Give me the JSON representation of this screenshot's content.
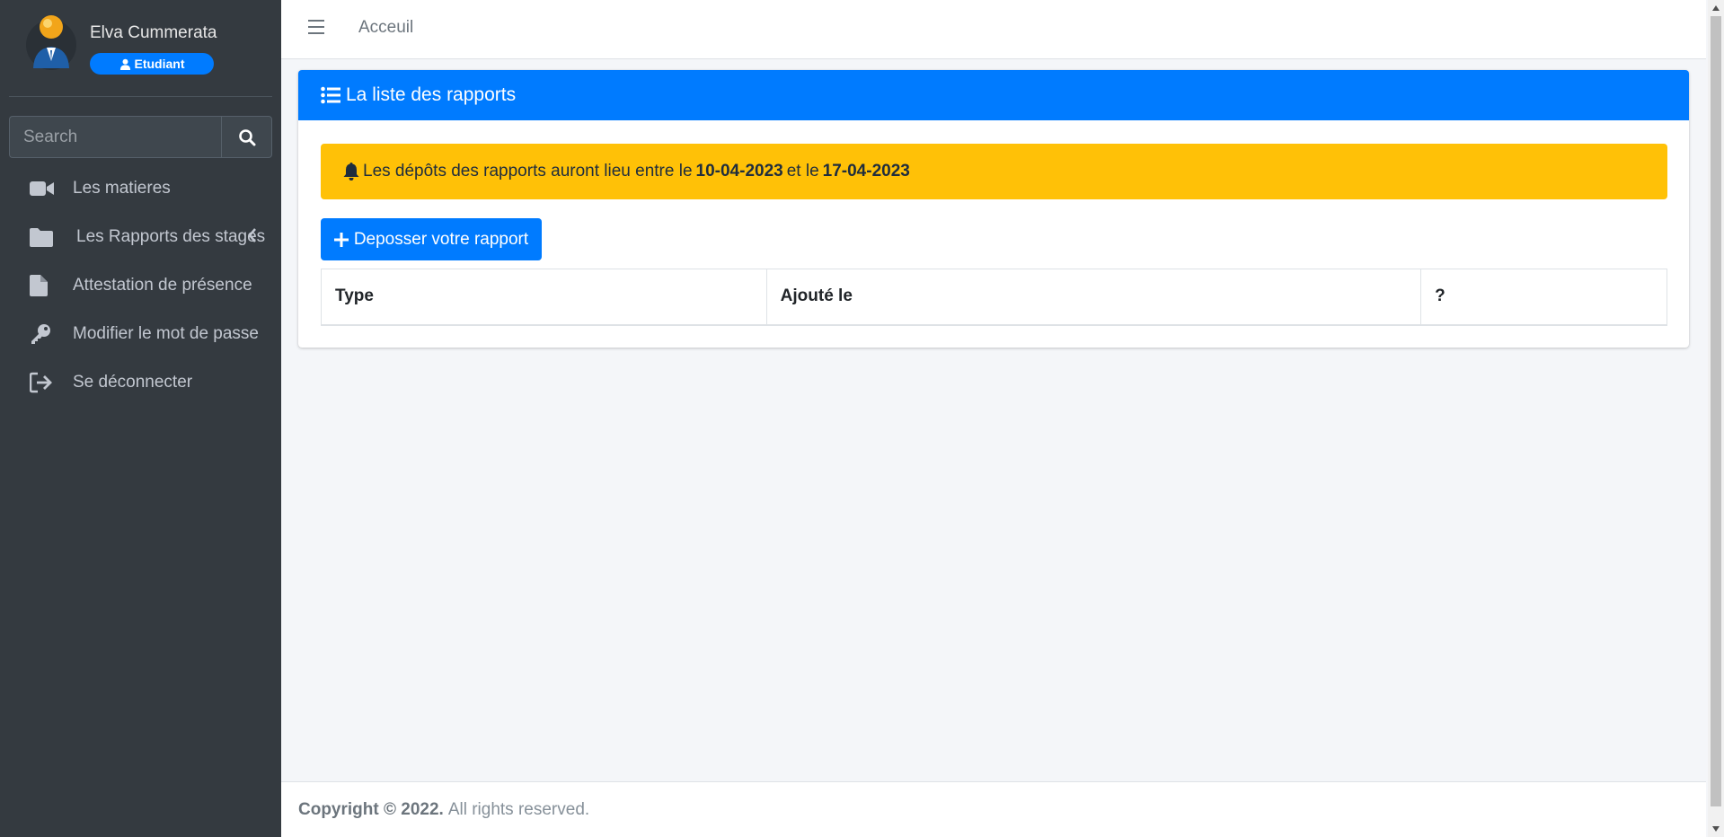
{
  "user": {
    "name": "Elva Cummerata",
    "role": "Etudiant"
  },
  "search": {
    "placeholder": "Search"
  },
  "sidebar": {
    "items": [
      {
        "label": "Les matieres",
        "icon": "video-icon"
      },
      {
        "label": "Les Rapports des stages",
        "icon": "folder-icon"
      },
      {
        "label": "Attestation de présence",
        "icon": "file-icon"
      },
      {
        "label": "Modifier le mot de passe",
        "icon": "key-icon"
      },
      {
        "label": "Se déconnecter",
        "icon": "sign-out-icon"
      }
    ]
  },
  "topbar": {
    "home_label": "Acceuil"
  },
  "card": {
    "title": "La liste des rapports",
    "alert": {
      "prefix": "Les dépôts des rapports auront lieu entre le",
      "start_date": "10-04-2023",
      "middle": "et le",
      "end_date": "17-04-2023"
    },
    "deposit_label": "Deposser votre rapport",
    "table_headers": [
      "Type",
      "Ajouté le",
      "?"
    ]
  },
  "footer": {
    "copyright": "Copyright © 2022.",
    "rights": "All rights reserved."
  },
  "colors": {
    "primary": "#007bff",
    "warning": "#ffc107",
    "sidebar_bg": "#343a40"
  }
}
